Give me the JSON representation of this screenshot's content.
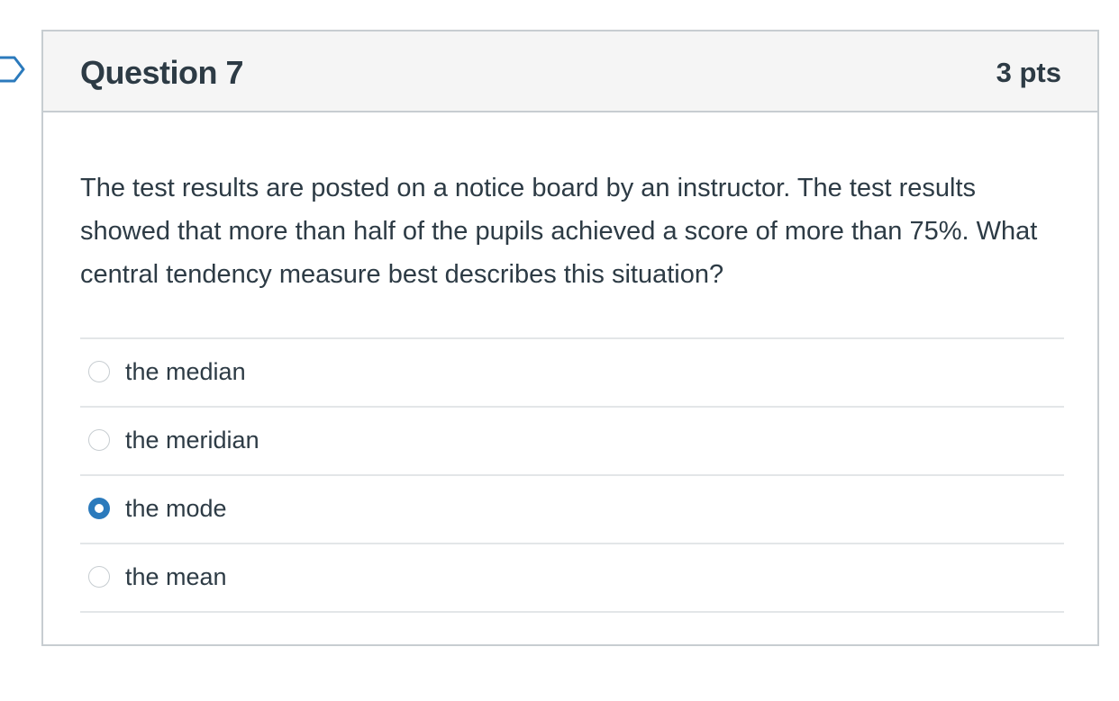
{
  "question": {
    "title": "Question 7",
    "points": "3 pts",
    "text": "The test results are posted on a notice board by an instructor. The test results showed that more than half of the pupils achieved a score of more than 75%. What central tendency measure best describes this situation?",
    "answers": [
      {
        "label": "the median",
        "selected": false
      },
      {
        "label": "the meridian",
        "selected": false
      },
      {
        "label": "the mode",
        "selected": true
      },
      {
        "label": "the mean",
        "selected": false
      }
    ]
  },
  "colors": {
    "accent": "#2b7abc",
    "text": "#2d3b45",
    "header_bg": "#f5f5f5",
    "border": "#c7cdd1"
  },
  "icons": {
    "flag": "question-flag-icon"
  }
}
